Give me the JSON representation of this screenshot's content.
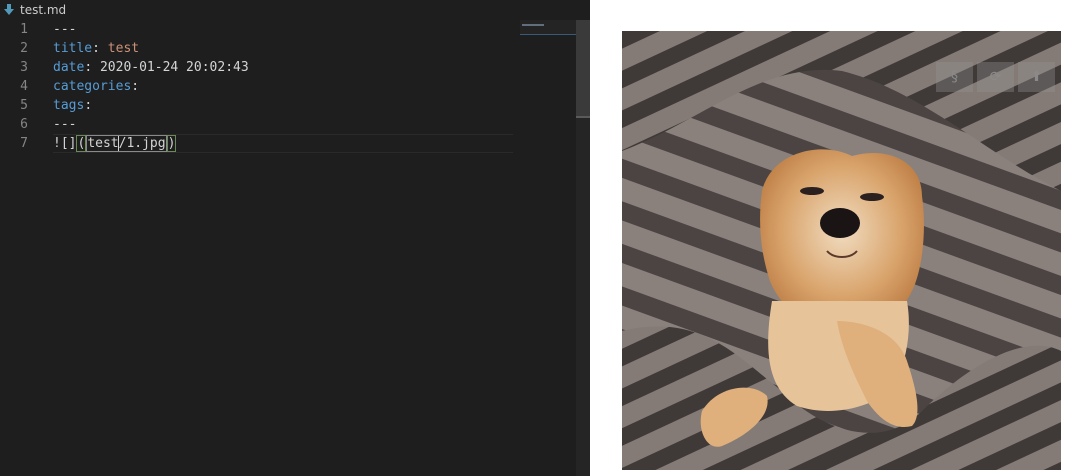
{
  "tab": {
    "filename": "test.md",
    "icon": "markdown-download-icon"
  },
  "editor": {
    "line_numbers": [
      "1",
      "2",
      "3",
      "4",
      "5",
      "6",
      "7"
    ],
    "lines": [
      {
        "plain": "---"
      },
      {
        "key": "title",
        "sep": ": ",
        "value": "test"
      },
      {
        "key": "date",
        "sep": ": ",
        "value": "2020-01-24 20:02:43"
      },
      {
        "key": "categories",
        "sep": ":"
      },
      {
        "key": "tags",
        "sep": ":"
      },
      {
        "plain": "---"
      },
      {
        "prefix": "![]",
        "path_open": "(",
        "path_a": "test",
        "path_b": "/1.jpg",
        "path_close": ")"
      }
    ]
  },
  "preview": {
    "image_subject": "shiba inu dog under striped blanket",
    "toolbar": [
      {
        "name": "sync-scroll-button",
        "glyph": "§"
      },
      {
        "name": "refresh-button",
        "glyph": "⟳"
      },
      {
        "name": "scroll-top-button",
        "glyph": "⬆"
      }
    ]
  },
  "colors": {
    "editor_bg": "#1e1e1e",
    "preview_bg": "#ffffff",
    "key": "#569cd6",
    "string": "#ce9178"
  }
}
